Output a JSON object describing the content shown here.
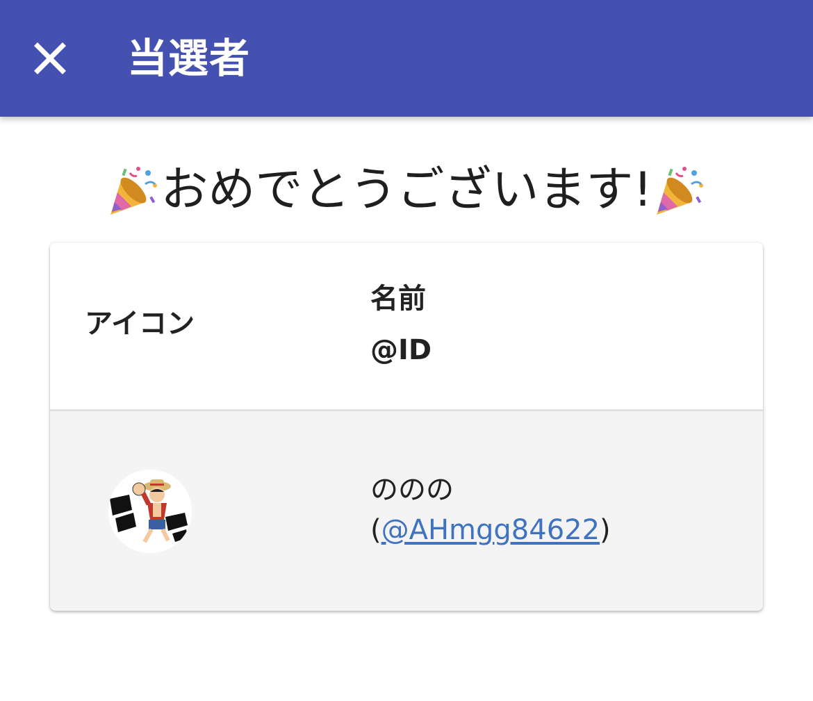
{
  "appbar": {
    "close_icon": "close-icon",
    "title": "当選者",
    "background": "#4551b0"
  },
  "congrats": {
    "icon_left": "party-popper-icon",
    "text": "おめでとうございます!",
    "icon_right": "party-popper-icon"
  },
  "table": {
    "headers": {
      "icon": "アイコン",
      "name": "名前",
      "id": "@ID"
    },
    "rows": [
      {
        "avatar": "avatar-image",
        "name": "ののの",
        "id_prefix": "(",
        "id_link": "@AHmgg84622",
        "id_suffix": ")"
      }
    ]
  },
  "colors": {
    "link": "#3f73c0",
    "row_bg": "#f4f4f4"
  }
}
